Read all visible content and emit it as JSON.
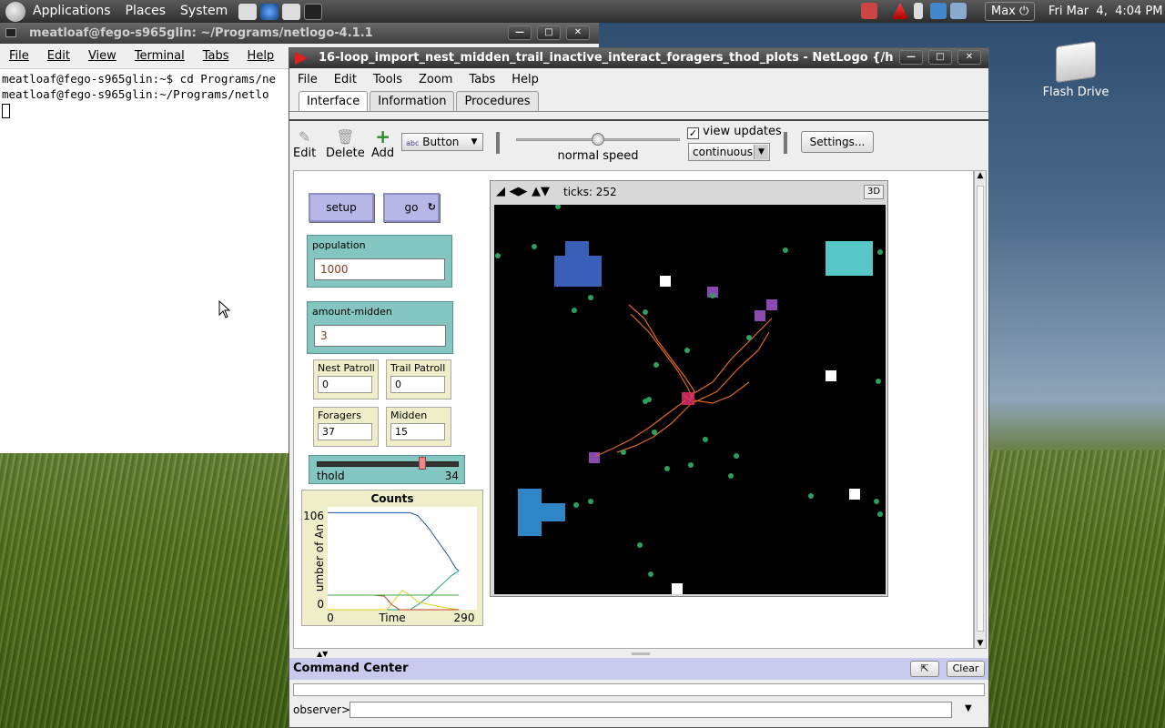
{
  "desktop": {
    "panel_menus": [
      "Applications",
      "Places",
      "System"
    ],
    "user": "Max",
    "clock": "Fri Mar  4,  4:04 PM",
    "flash_drive_label": "Flash Drive"
  },
  "terminal": {
    "title": "meatloaf@fego-s965glin: ~/Programs/netlogo-4.1.1",
    "menus": [
      "File",
      "Edit",
      "View",
      "Terminal",
      "Tabs",
      "Help"
    ],
    "lines": [
      "meatloaf@fego-s965glin:~$ cd Programs/ne",
      "meatloaf@fego-s965glin:~/Programs/netlo"
    ]
  },
  "netlogo": {
    "title": "16-loop_import_nest_midden_trail_inactive_interact_foragers_thod_plots - NetLogo  {/h",
    "menus": [
      "File",
      "Edit",
      "Tools",
      "Zoom",
      "Tabs",
      "Help"
    ],
    "tabs": [
      "Interface",
      "Information",
      "Procedures"
    ],
    "toolbar": {
      "edit": "Edit",
      "delete": "Delete",
      "add": "Add",
      "widget_type": "Button",
      "speed_label": "normal speed",
      "speed": 0.5,
      "view_updates": "view updates",
      "update_mode": "continuous",
      "settings": "Settings...",
      "view_updates_checked": true
    },
    "buttons": {
      "setup": "setup",
      "go": "go"
    },
    "inputs": {
      "population": {
        "label": "population",
        "value": "1000"
      },
      "amount_midden": {
        "label": "amount-midden",
        "value": "3"
      }
    },
    "monitors": [
      {
        "label": "Nest Patroll",
        "value": "0"
      },
      {
        "label": "Trail Patroll",
        "value": "0"
      },
      {
        "label": "Foragers",
        "value": "37"
      },
      {
        "label": "Midden",
        "value": "15"
      }
    ],
    "slider": {
      "label": "thold",
      "value": "34",
      "fraction": 0.76
    },
    "world": {
      "ticks": "ticks: 252",
      "button_3d": "3D"
    },
    "command_center": {
      "title": "Command Center",
      "clear": "Clear",
      "prompt": "observer>"
    }
  },
  "chart_data": {
    "type": "line",
    "title": "Counts",
    "xlabel": "Time",
    "ylabel": "umber of An",
    "xlim": [
      0,
      290
    ],
    "ylim": [
      0,
      106
    ],
    "x_ticks": [
      "0",
      "290"
    ],
    "y_ticks": [
      "0",
      "106"
    ],
    "series": [
      {
        "color": "#2050a8",
        "points": [
          [
            0,
            100
          ],
          [
            160,
            100
          ],
          [
            175,
            97
          ],
          [
            195,
            85
          ],
          [
            215,
            70
          ],
          [
            235,
            55
          ],
          [
            250,
            42
          ],
          [
            255,
            40
          ]
        ]
      },
      {
        "color": "#20a080",
        "points": [
          [
            0,
            0
          ],
          [
            145,
            0
          ],
          [
            160,
            0
          ],
          [
            175,
            5
          ],
          [
            200,
            15
          ],
          [
            220,
            25
          ],
          [
            240,
            35
          ],
          [
            255,
            40
          ]
        ]
      },
      {
        "color": "#e0d020",
        "points": [
          [
            0,
            0
          ],
          [
            115,
            0
          ],
          [
            130,
            10
          ],
          [
            145,
            20
          ],
          [
            160,
            15
          ],
          [
            175,
            8
          ],
          [
            200,
            5
          ],
          [
            230,
            2
          ],
          [
            255,
            0
          ]
        ]
      },
      {
        "color": "#c04020",
        "points": [
          [
            0,
            15
          ],
          [
            90,
            15
          ],
          [
            110,
            14
          ],
          [
            125,
            5
          ],
          [
            140,
            0
          ],
          [
            255,
            0
          ]
        ]
      },
      {
        "color": "#40a040",
        "points": [
          [
            0,
            15
          ],
          [
            255,
            15
          ]
        ]
      }
    ]
  }
}
